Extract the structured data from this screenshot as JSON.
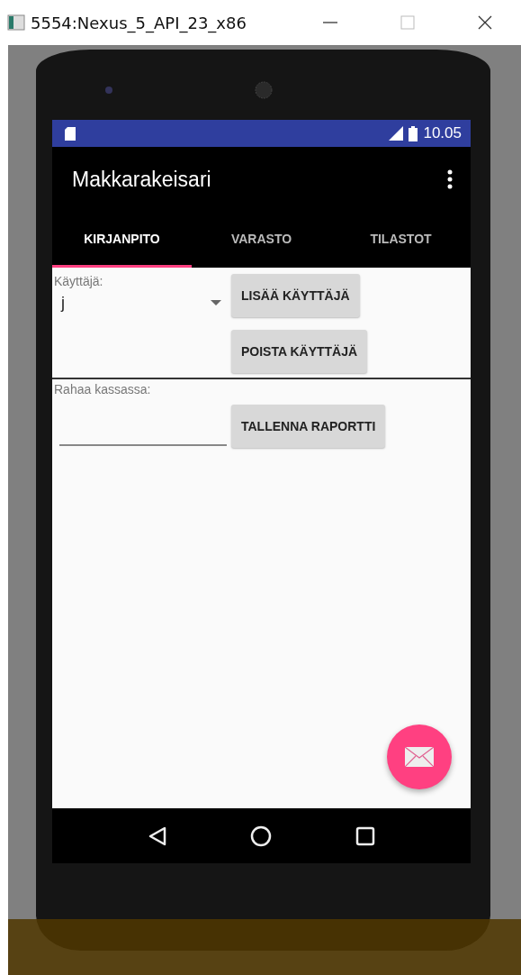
{
  "window": {
    "title": "5554:Nexus_5_API_23_x86"
  },
  "status_bar": {
    "time": "10.05"
  },
  "app_bar": {
    "title": "Makkarakeisari"
  },
  "tabs": [
    {
      "label": "KIRJANPITO",
      "selected": true
    },
    {
      "label": "VARASTO",
      "selected": false
    },
    {
      "label": "TILASTOT",
      "selected": false
    }
  ],
  "user_section": {
    "label": "Käyttäjä:",
    "spinner_value": "j",
    "buttons": [
      "LISÄÄ KÄYTTÄJÄ",
      "POISTA KÄYTTÄJÄ"
    ]
  },
  "cash_section": {
    "label": "Rahaa kassassa:",
    "button": "TALLENNA RAPORTTI"
  }
}
